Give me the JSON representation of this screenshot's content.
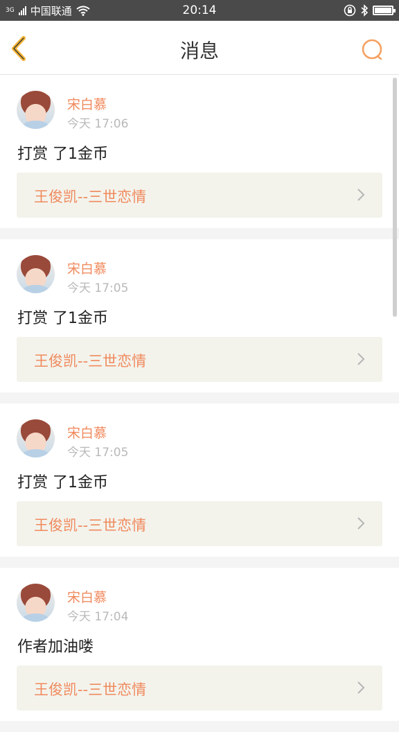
{
  "status_bar": {
    "network_type": "3G",
    "carrier": "中国联通",
    "time": "20:14",
    "battery_level": 1.0,
    "icons": [
      "signal-icon",
      "wifi-icon",
      "rotation-lock-icon",
      "bluetooth-icon",
      "battery-icon"
    ]
  },
  "header": {
    "title": "消息",
    "back_icon": "chevron-left-icon",
    "search_icon": "search-icon",
    "accent_color": "#f5b333",
    "search_color": "#f5a162"
  },
  "messages": [
    {
      "username": "宋白慕",
      "time": "今天 17:06",
      "text": "打赏 了1金币",
      "link": "王俊凯--三世恋情"
    },
    {
      "username": "宋白慕",
      "time": "今天 17:05",
      "text": "打赏 了1金币",
      "link": "王俊凯--三世恋情"
    },
    {
      "username": "宋白慕",
      "time": "今天 17:05",
      "text": "打赏 了1金币",
      "link": "王俊凯--三世恋情"
    },
    {
      "username": "宋白慕",
      "time": "今天 17:04",
      "text": "作者加油喽",
      "link": "王俊凯--三世恋情"
    }
  ],
  "colors": {
    "username": "#f08a5d",
    "link": "#f08a5d",
    "timestamp": "#b9b9b9",
    "link_box_bg": "#f3f3ec"
  }
}
